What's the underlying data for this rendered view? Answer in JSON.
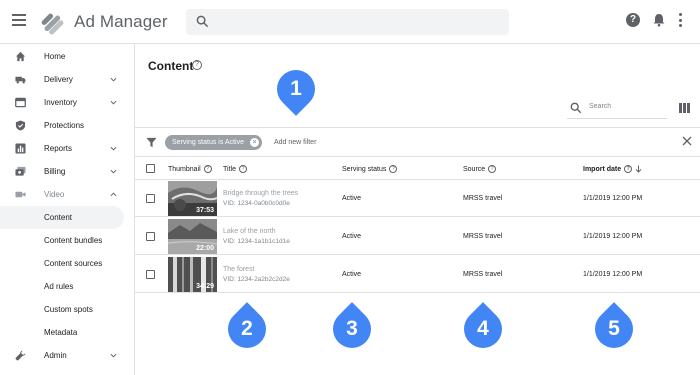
{
  "app": {
    "title": "Ad Manager"
  },
  "sidebar": {
    "items": [
      {
        "label": "Home",
        "icon": "home-icon",
        "expandable": false
      },
      {
        "label": "Delivery",
        "icon": "truck-icon",
        "expandable": true
      },
      {
        "label": "Inventory",
        "icon": "inventory-icon",
        "expandable": true
      },
      {
        "label": "Protections",
        "icon": "shield-icon",
        "expandable": false
      },
      {
        "label": "Reports",
        "icon": "bar-chart-icon",
        "expandable": true
      },
      {
        "label": "Billing",
        "icon": "billing-icon",
        "expandable": true
      },
      {
        "label": "Video",
        "icon": "video-camera-icon",
        "expandable": true,
        "expanded": true
      }
    ],
    "video_sub_items": [
      "Content",
      "Content bundles",
      "Content sources",
      "Ad rules",
      "Custom spots",
      "Metadata"
    ],
    "active_sub_item": "Content",
    "admin": {
      "label": "Admin",
      "icon": "wrench-icon"
    }
  },
  "main": {
    "title": "Content",
    "search_placeholder": "Search",
    "filter": {
      "chip_label": "Serving status is Active",
      "add_filter_label": "Add new filter"
    },
    "columns": {
      "thumbnail": "Thumbnail",
      "title": "Title",
      "serving_status": "Serving status",
      "source": "Source",
      "import_date": "Import date"
    },
    "rows": [
      {
        "duration": "37:53",
        "title": "Bridge through the trees",
        "vid": "VID: 1234-0a0b0c0d0e",
        "status": "Active",
        "source": "MRSS travel",
        "import_date": "1/1/2019 12:00 PM"
      },
      {
        "duration": "22:00",
        "title": "Lake of the north",
        "vid": "VID: 1234-1a1b1c1d1e",
        "status": "Active",
        "source": "MRSS travel",
        "import_date": "1/1/2019 12:00 PM"
      },
      {
        "duration": "34:29",
        "title": "The forest",
        "vid": "VID: 1234-2a2b2c2d2e",
        "status": "Active",
        "source": "MRSS travel",
        "import_date": "1/1/2019 12:00 PM"
      }
    ]
  },
  "callouts": [
    "1",
    "2",
    "3",
    "4",
    "5"
  ],
  "colors": {
    "callout": "#4285f4",
    "chip": "#9aa0a6"
  }
}
